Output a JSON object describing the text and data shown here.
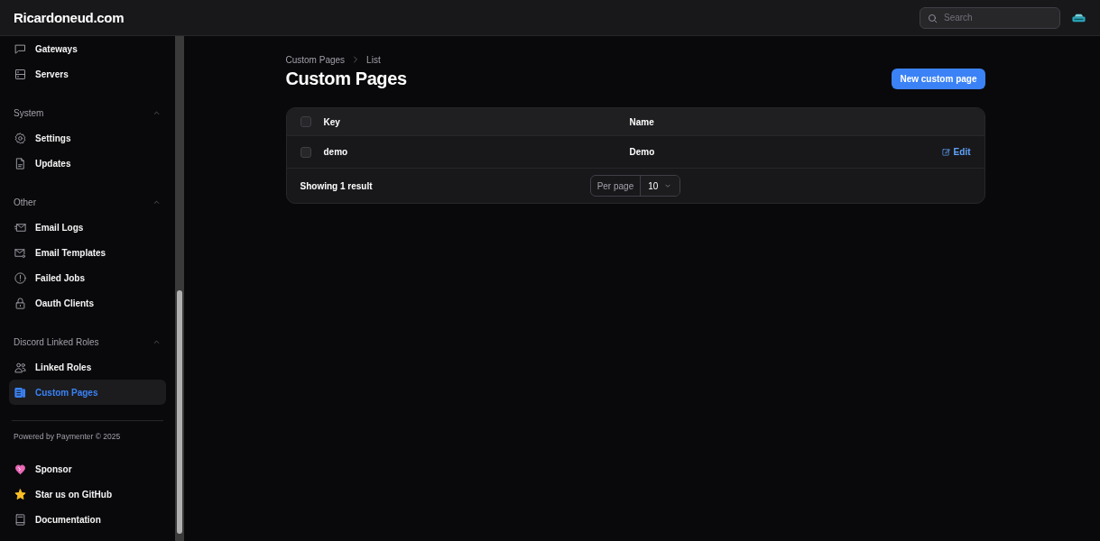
{
  "header": {
    "brand": "Ricardoneud.com",
    "search": {
      "placeholder": "Search"
    }
  },
  "sidebar": {
    "top_items": [
      {
        "label": "Gateways",
        "selected": false
      },
      {
        "label": "Servers",
        "selected": false
      }
    ],
    "groups": [
      {
        "title": "System",
        "expanded": true,
        "items": [
          {
            "label": "Settings",
            "selected": false
          },
          {
            "label": "Updates",
            "selected": false
          }
        ]
      },
      {
        "title": "Other",
        "expanded": true,
        "items": [
          {
            "label": "Email Logs",
            "selected": false
          },
          {
            "label": "Email Templates",
            "selected": false
          },
          {
            "label": "Failed Jobs",
            "selected": false
          },
          {
            "label": "Oauth Clients",
            "selected": false
          }
        ]
      },
      {
        "title": "Discord Linked Roles",
        "expanded": true,
        "items": [
          {
            "label": "Linked Roles",
            "selected": false
          },
          {
            "label": "Custom Pages",
            "selected": true
          }
        ]
      }
    ],
    "footer_note": "Powered by Paymenter © 2025",
    "footer_links": [
      {
        "label": "Sponsor"
      },
      {
        "label": "Star us on GitHub"
      },
      {
        "label": "Documentation"
      }
    ]
  },
  "breadcrumb": [
    "Custom Pages",
    "List"
  ],
  "page_title": "Custom Pages",
  "primary_action": "New custom page",
  "table": {
    "select_all_checked": false,
    "columns": [
      "Key",
      "Name"
    ],
    "rows": [
      {
        "checked": false,
        "key": "demo",
        "name": "Demo",
        "action": "Edit"
      }
    ],
    "result_text": "Showing 1 result",
    "per_page_label": "Per page",
    "per_page_value": "10"
  }
}
